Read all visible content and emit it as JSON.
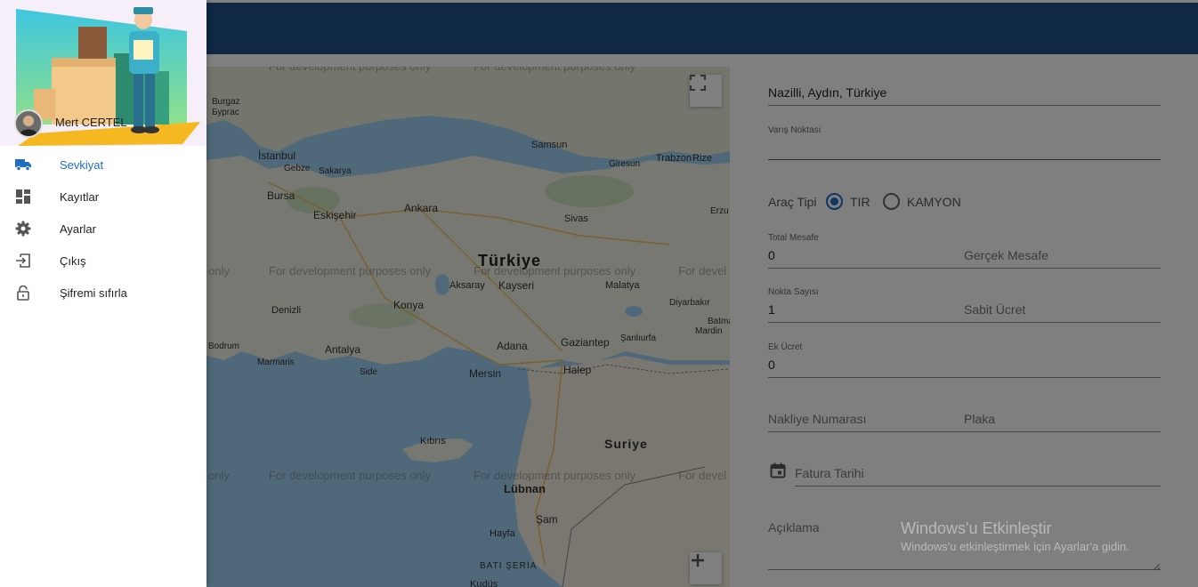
{
  "user": {
    "name": "Mert CERTEL"
  },
  "nav": {
    "items": [
      {
        "label": "Sevkiyat",
        "icon": "truck-icon",
        "active": true
      },
      {
        "label": "Kayıtlar",
        "icon": "dashboard-icon",
        "active": false
      },
      {
        "label": "Ayarlar",
        "icon": "gear-icon",
        "active": false
      },
      {
        "label": "Çıkış",
        "icon": "logout-icon",
        "active": false
      },
      {
        "label": "Şifremi sıfırla",
        "icon": "lock-icon",
        "active": false
      }
    ]
  },
  "map": {
    "watermark": "For development purposes only",
    "partial_labels": [
      "only",
      "For devel"
    ],
    "places": [
      {
        "name": "Türkiye"
      },
      {
        "name": "İstanbul"
      },
      {
        "name": "Bursa"
      },
      {
        "name": "Eskişehir"
      },
      {
        "name": "Ankara"
      },
      {
        "name": "Samsun"
      },
      {
        "name": "Trabzon"
      },
      {
        "name": "Rize"
      },
      {
        "name": "Sivas"
      },
      {
        "name": "Kayseri"
      },
      {
        "name": "Aksaray"
      },
      {
        "name": "Malatya"
      },
      {
        "name": "Konya"
      },
      {
        "name": "Denizli"
      },
      {
        "name": "Antalya"
      },
      {
        "name": "Adana"
      },
      {
        "name": "Gaziantep"
      },
      {
        "name": "Mersin"
      },
      {
        "name": "Halep"
      },
      {
        "name": "Kıbrıs"
      },
      {
        "name": "Suriye"
      },
      {
        "name": "Şam"
      },
      {
        "name": "Hayfa"
      },
      {
        "name": "Diyarbakır"
      },
      {
        "name": "Şanlıurfa"
      },
      {
        "name": "Batman"
      },
      {
        "name": "Mardin"
      },
      {
        "name": "Giresun"
      },
      {
        "name": "Gebze"
      },
      {
        "name": "Sakarya"
      },
      {
        "name": "Burgaz"
      },
      {
        "name": "Бургас"
      },
      {
        "name": "Erzu"
      },
      {
        "name": "Side"
      },
      {
        "name": "Marmaris"
      },
      {
        "name": "Bodrum"
      },
      {
        "name": "Lübnan"
      },
      {
        "name": "BATI ŞERİA"
      },
      {
        "name": "Kudüs"
      }
    ]
  },
  "form": {
    "origin_value": "Nazilli, Aydın, Türkiye",
    "destination_label": "Varış Noktası",
    "vehicle_type_label": "Araç Tipi",
    "vehicle_options": [
      {
        "label": "TIR",
        "selected": true
      },
      {
        "label": "KAMYON",
        "selected": false
      }
    ],
    "total_distance_label": "Total Mesafe",
    "total_distance_value": "0",
    "real_distance_placeholder": "Gerçek Mesafe",
    "point_count_label": "Nokta Sayısı",
    "point_count_value": "1",
    "fixed_fee_placeholder": "Sabit Ücret",
    "extra_fee_label": "Ek Ücret",
    "extra_fee_value": "0",
    "shipment_number_placeholder": "Nakliye Numarası",
    "plate_placeholder": "Plaka",
    "invoice_date_placeholder": "Fatura Tarihi",
    "description_placeholder": "Açıklama"
  },
  "windows_watermark": {
    "title": "Windows'u Etkinleştir",
    "subtitle": "Windows'u etkinleştirmek için Ayarlar'a gidin."
  },
  "colors": {
    "appbar": "#1e5088",
    "accent": "#1e6fc4",
    "overlay": "rgba(0,0,0,0.5)"
  }
}
